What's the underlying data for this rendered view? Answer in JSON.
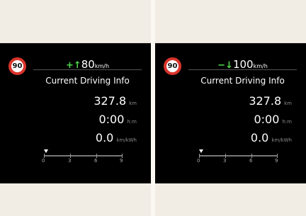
{
  "panels": [
    {
      "sign": "90",
      "speed_value": "80",
      "speed_unit": "km/h",
      "title": "Current Driving Info",
      "distance": "327.8",
      "distance_unit": "km",
      "time": "0:00",
      "time_unit": "h:m",
      "efficiency": "0.0",
      "efficiency_unit": "km/kWh",
      "scale": [
        "0",
        "3",
        "6",
        "9"
      ],
      "arrow": "up",
      "arrow_glyph": "+↑"
    },
    {
      "sign": "90",
      "speed_value": "100",
      "speed_unit": "km/h",
      "title": "Current Driving Info",
      "distance": "327.8",
      "distance_unit": "km",
      "time": "0:00",
      "time_unit": "h:m",
      "efficiency": "0.0",
      "efficiency_unit": "km/kWh",
      "scale": [
        "0",
        "3",
        "6",
        "9"
      ],
      "arrow": "down",
      "arrow_glyph": "−↓"
    }
  ],
  "colors": {
    "sign_ring": "#d9342b",
    "arrow_green": "#4fd84a",
    "panel_bg": "#000000",
    "page_bg": "#f2ede4"
  }
}
